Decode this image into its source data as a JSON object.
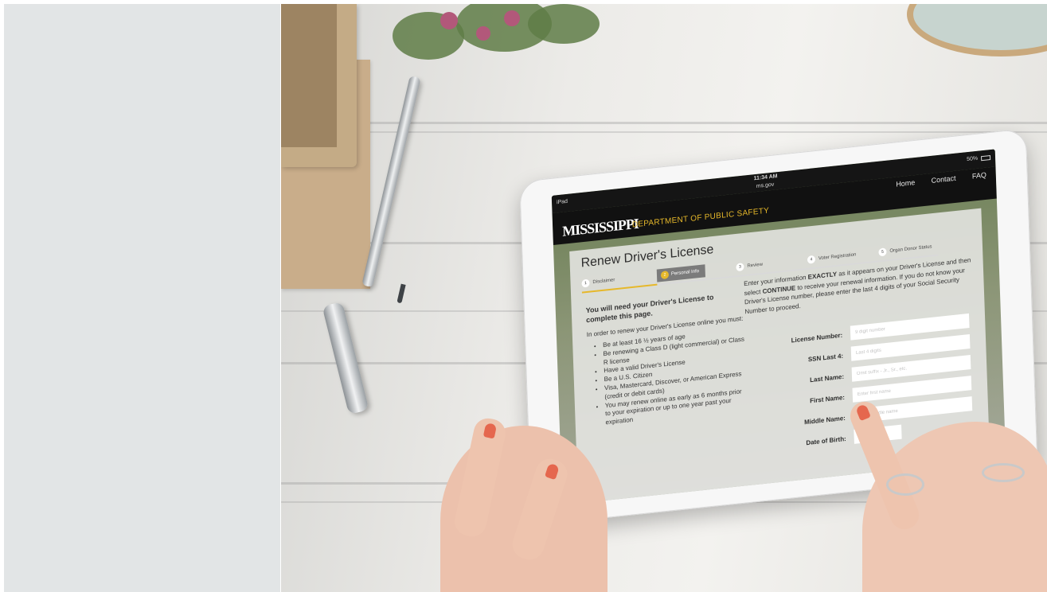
{
  "tablet_status": {
    "device": "iPad",
    "time": "11:34 AM",
    "url": "ms.gov",
    "battery": "50%"
  },
  "site": {
    "logo_text": "MISSISSIPPI",
    "department": "DEPARTMENT OF PUBLIC SAFETY",
    "nav": {
      "home": "Home",
      "contact": "Contact",
      "faq": "FAQ"
    }
  },
  "page": {
    "title": "Renew Driver's License",
    "steps": [
      {
        "num": "1",
        "label": "Disclaimer"
      },
      {
        "num": "2",
        "label": "Personal Info"
      },
      {
        "num": "3",
        "label": "Review"
      },
      {
        "num": "4",
        "label": "Voter Registration"
      },
      {
        "num": "5",
        "label": "Organ Donor Status"
      }
    ],
    "active_step": 2
  },
  "requirements": {
    "heading": "You will need your Driver's License to complete this page.",
    "intro": "In order to renew your Driver's License online you must:",
    "items": [
      "Be at least 16 ½ years of age",
      "Be renewing a Class D (light commercial) or Class R license",
      "Have a valid Driver's License",
      "Be a U.S. Citizen",
      "Visa, Mastercard, Discover, or American Express (credit or debit cards)",
      "You may renew online as early as 6 months prior to your expiration or up to one year past your expiration"
    ]
  },
  "instructions": {
    "pre": "Enter your information ",
    "bold1": "EXACTLY",
    "mid": " as it appears on your Driver's License and then select ",
    "bold2": "CONTINUE",
    "post": " to receive your renewal information. If you do not know your Driver's License number, please enter the last 4 digits of your Social Security Number to proceed."
  },
  "form": {
    "license_label": "License Number:",
    "license_placeholder": "9 digit number",
    "ssn_label": "SSN Last 4:",
    "ssn_placeholder": "Last 4 digits",
    "last_label": "Last Name:",
    "last_placeholder": "Omit suffix - Jr., Sr., etc.",
    "first_label": "First Name:",
    "first_placeholder": "Enter first name",
    "middle_label": "Middle Name:",
    "middle_placeholder": "Enter middle name",
    "dob_label": "Date of Birth:",
    "dob_month": "month"
  }
}
